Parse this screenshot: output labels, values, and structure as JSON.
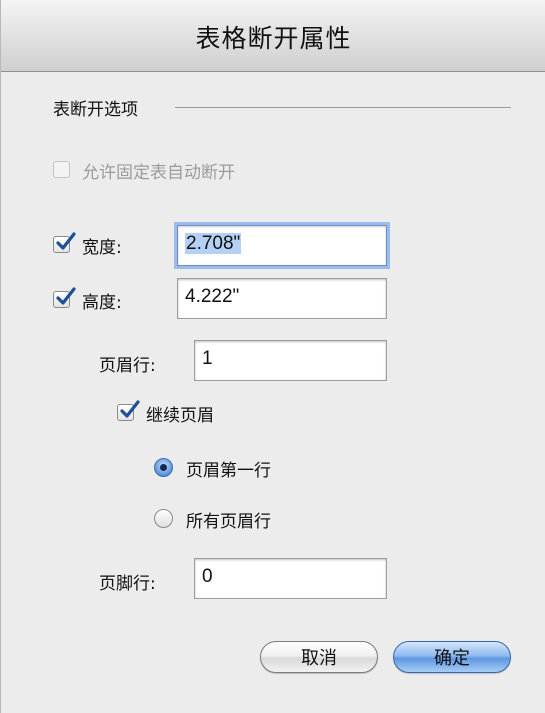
{
  "dialog": {
    "title": "表格断开属性",
    "section_label": "表断开选项",
    "allow_fixed_break": {
      "label": "允许固定表自动断开",
      "checked": false,
      "enabled": false
    },
    "width": {
      "label": "宽度:",
      "checked": true,
      "value": "2.708\""
    },
    "height": {
      "label": "高度:",
      "checked": true,
      "value": "4.222\""
    },
    "header_rows": {
      "label": "页眉行:",
      "value": "1"
    },
    "continue_header": {
      "label": "继续页眉",
      "checked": true
    },
    "header_option_first": {
      "label": "页眉第一行",
      "selected": true
    },
    "header_option_all": {
      "label": "所有页眉行",
      "selected": false
    },
    "footer_rows": {
      "label": "页脚行:",
      "value": "0"
    },
    "cancel_label": "取消",
    "ok_label": "确定"
  },
  "colors": {
    "dialog_bg": "#ececec",
    "accent": "#5d97e2",
    "check": "#1f4f99"
  },
  "icons": {
    "checkmark": "checkmark-icon",
    "radio": "radio-dot-icon"
  }
}
